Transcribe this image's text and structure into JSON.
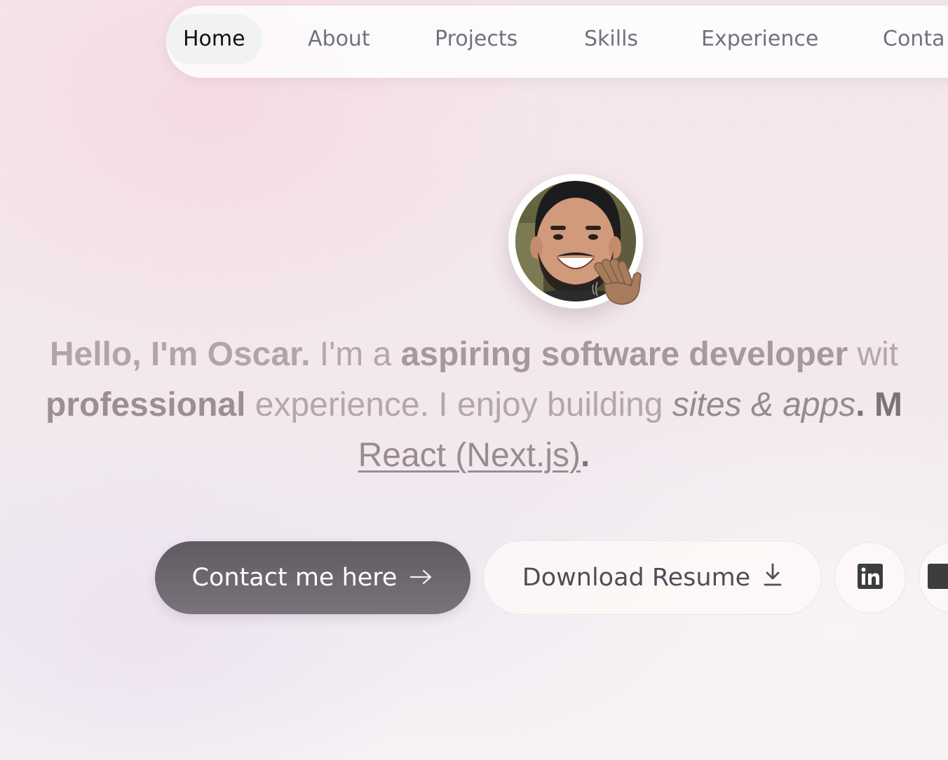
{
  "nav": {
    "items": [
      {
        "label": "Home",
        "active": true
      },
      {
        "label": "About",
        "active": false
      },
      {
        "label": "Projects",
        "active": false
      },
      {
        "label": "Skills",
        "active": false
      },
      {
        "label": "Experience",
        "active": false
      },
      {
        "label": "Conta",
        "active": false
      }
    ]
  },
  "hero": {
    "avatar_icon": "person-photo",
    "wave_icon": "waving-hand-icon",
    "intro": {
      "greeting": "Hello, I'm Oscar.",
      "role_prefix": " I'm a ",
      "role": "aspiring software developer",
      "with_cut": " wit",
      "professional": "professional",
      "experience": " experience. I enjoy building ",
      "sites_apps": "sites & apps",
      "period_m": ". M",
      "tech": "React (Next.js)",
      "end": "."
    }
  },
  "actions": {
    "contact_label": "Contact me here",
    "contact_icon": "arrow-right-icon",
    "resume_label": "Download Resume",
    "resume_icon": "download-icon",
    "linkedin_icon": "linkedin-icon",
    "github_icon": "github-icon"
  },
  "colors": {
    "contact_button": "#6a646d",
    "nav_active_bg": "#f1f2f4",
    "text_muted": "#b5a6aa"
  }
}
